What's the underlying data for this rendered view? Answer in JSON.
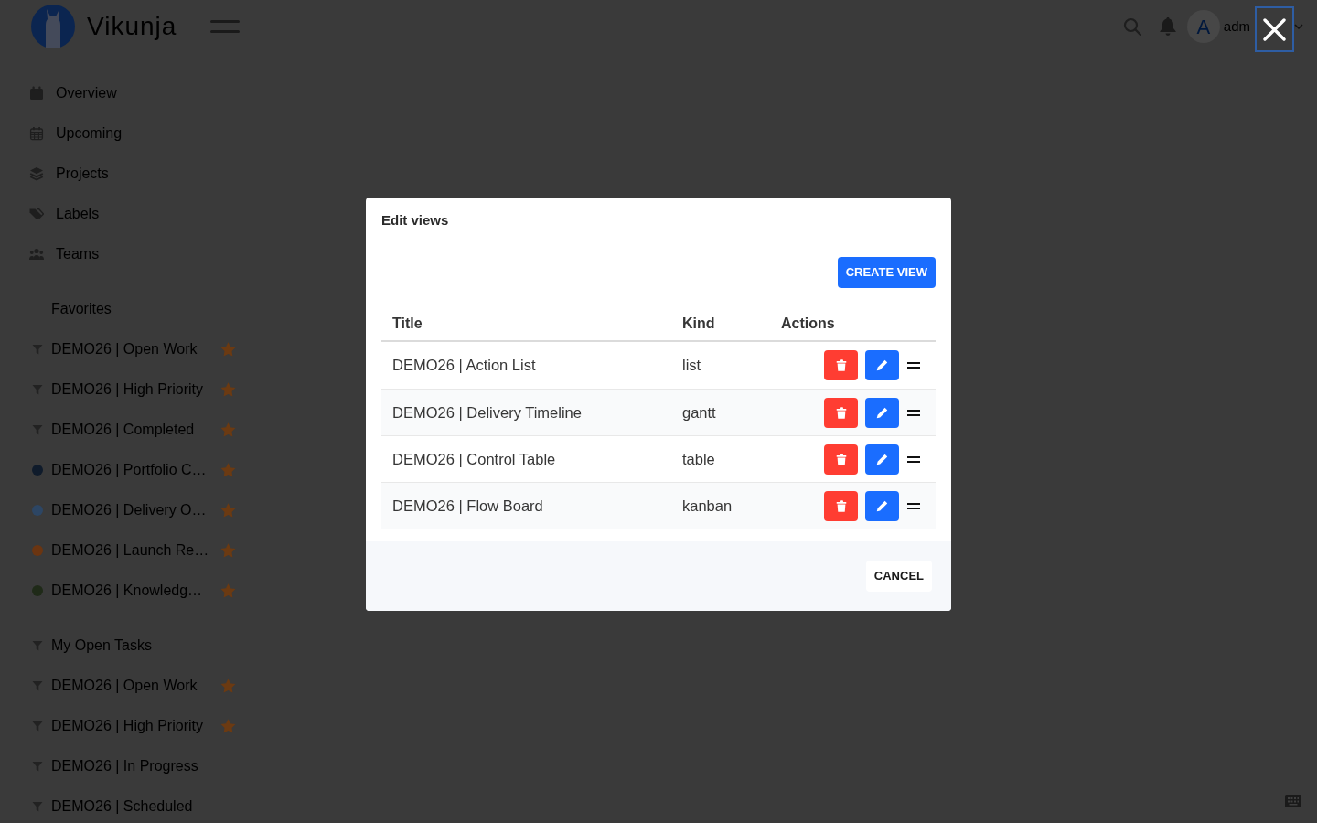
{
  "top_bar": {
    "logo_text": "Vikunja",
    "avatar_letter": "A",
    "username": "adm"
  },
  "sidebar": {
    "menu": [
      {
        "label": "Overview"
      },
      {
        "label": "Upcoming"
      },
      {
        "label": "Projects"
      },
      {
        "label": "Labels"
      },
      {
        "label": "Teams"
      }
    ],
    "favorites_title": "Favorites",
    "favorites": [
      {
        "kind": "filter",
        "label": "DEMO26 | Open Work",
        "favorite": true
      },
      {
        "kind": "filter",
        "label": "DEMO26 | High Priority",
        "favorite": true
      },
      {
        "kind": "filter",
        "label": "DEMO26 | Completed",
        "favorite": true
      },
      {
        "kind": "project",
        "label": "DEMO26 | Portfolio C…",
        "color": "#0f1b2b",
        "favorite": true
      },
      {
        "kind": "project",
        "label": "DEMO26 | Delivery O…",
        "color": "#2d4664",
        "favorite": true
      },
      {
        "kind": "project",
        "label": "DEMO26 | Launch Re…",
        "color": "#6b3511",
        "favorite": true
      },
      {
        "kind": "project",
        "label": "DEMO26 | Knowledg…",
        "color": "#1f2a18",
        "favorite": true
      }
    ],
    "projects": [
      {
        "kind": "filter",
        "label": "My Open Tasks",
        "favorite": false
      },
      {
        "kind": "filter",
        "label": "DEMO26 | Open Work",
        "favorite": true
      },
      {
        "kind": "filter",
        "label": "DEMO26 | High Priority",
        "favorite": true
      },
      {
        "kind": "filter",
        "label": "DEMO26 | In Progress",
        "favorite": false
      },
      {
        "kind": "filter",
        "label": "DEMO26 | Scheduled",
        "favorite": false
      }
    ]
  },
  "modal": {
    "title": "Edit views",
    "create_button": "CREATE VIEW",
    "columns": [
      "Title",
      "Kind",
      "Actions"
    ],
    "rows": [
      {
        "title": "DEMO26 | Action List",
        "view_kind": "list"
      },
      {
        "title": "DEMO26 | Delivery Timeline",
        "view_kind": "gantt"
      },
      {
        "title": "DEMO26 | Control Table",
        "view_kind": "table"
      },
      {
        "title": "DEMO26 | Flow Board",
        "view_kind": "kanban"
      }
    ],
    "cancel_button": "CANCEL"
  }
}
